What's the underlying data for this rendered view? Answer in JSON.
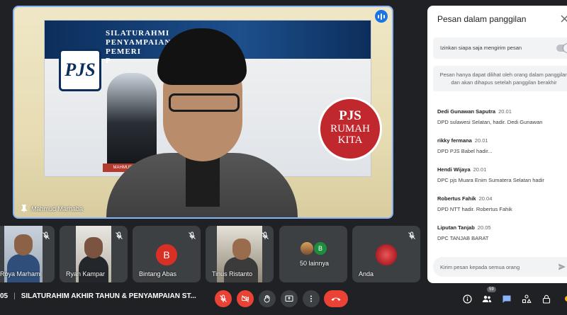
{
  "main_speaker": {
    "name": "Mahmud Marhaba",
    "banner_lines": [
      "SILATURAHMI",
      "PENYAMPAIAN",
      "PEMERI",
      "P"
    ],
    "banner_logo": "PJS",
    "banner_caption": "MAHMUD MARHABA, S.PA",
    "circle_line1": "PJS",
    "circle_line2": "RUMAH",
    "circle_line3": "KITA",
    "audio_icon": "audio-wave-icon"
  },
  "participants": [
    {
      "name": "Roya Marhami",
      "mic": "mic-off-icon"
    },
    {
      "name": "Ryan Kampar",
      "mic": "mic-off-icon"
    },
    {
      "name": "Bintang Abas",
      "avatar_letter": "B",
      "mic": "mic-off-icon"
    },
    {
      "name": "Tinus Ristanto",
      "mic": "mic-off-icon"
    },
    {
      "name": "50 lainnya",
      "avatar_letter": "B"
    },
    {
      "name": "Anda",
      "mic": "mic-off-icon"
    }
  ],
  "meeting": {
    "time": "05",
    "title": "SILATURAHIM AKHIR TAHUN & PENYAMPAIAN ST..."
  },
  "controls": {
    "mic": "mic-off-icon",
    "camera": "camera-off-icon",
    "hand": "raise-hand-icon",
    "present": "present-screen-icon",
    "more": "more-options-icon",
    "leave": "end-call-icon"
  },
  "right_controls": {
    "participant_count": "59",
    "icons": [
      "info-icon",
      "people-icon",
      "chat-icon",
      "activities-icon",
      "lock-icon"
    ]
  },
  "chat": {
    "title": "Pesan dalam panggilan",
    "allow_label": "Izinkan siapa saja mengirim pesan",
    "notice_line1": "Pesan hanya dapat dilihat oleh orang dalam panggilan",
    "notice_line2": "dan akan dihapus setelah panggilan berakhir",
    "messages": [
      {
        "sender": "Dedi Gunawan Saputra",
        "time": "20.01",
        "text": "DPD sulawesi Selatan, hadir. Dedi Gunawan"
      },
      {
        "sender": "rikky fermana",
        "time": "20.01",
        "text": "DPD PJS Babel hadir..."
      },
      {
        "sender": "Hendi Wijaya",
        "time": "20.01",
        "text": "DPC pjs Muara Enim Sumatera Selatan hadir"
      },
      {
        "sender": "Robertus Fahik",
        "time": "20.04",
        "text": "DPD NTT hadir. Robertus Fahik"
      },
      {
        "sender": "Liputan Tanjab",
        "time": "20.05",
        "text": "DPC TANJAB BARAT"
      }
    ],
    "input_placeholder": "Kirim pesan kepada semua orang"
  },
  "colors": {
    "background": "#202124",
    "active_speaker_border": "#8ab4f8",
    "danger": "#ea4335",
    "tile": "#3c4043",
    "avatar_red": "#d93025",
    "avatar_green": "#1e8e3e"
  }
}
